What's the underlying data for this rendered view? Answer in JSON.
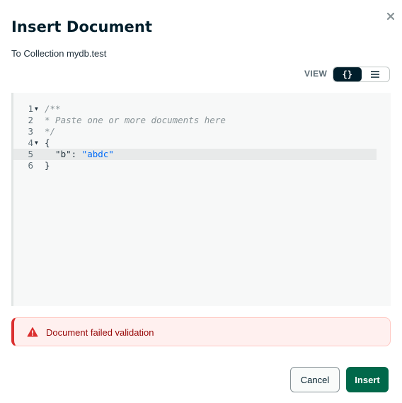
{
  "modal": {
    "title": "Insert Document",
    "subtitle": "To Collection mydb.test",
    "close_icon": "close-icon"
  },
  "view_toggle": {
    "label": "VIEW",
    "options": [
      {
        "name": "json-view",
        "icon": "braces-icon",
        "glyph": "{}",
        "active": true
      },
      {
        "name": "list-view",
        "icon": "list-icon",
        "glyph": "☰",
        "active": false
      }
    ]
  },
  "editor": {
    "lines": [
      {
        "number": "1",
        "foldable": true,
        "tokens": [
          {
            "type": "comment",
            "text": "/**"
          }
        ]
      },
      {
        "number": "2",
        "foldable": false,
        "tokens": [
          {
            "type": "comment",
            "text": "* Paste one or more documents here"
          }
        ]
      },
      {
        "number": "3",
        "foldable": false,
        "tokens": [
          {
            "type": "comment",
            "text": "*/"
          }
        ]
      },
      {
        "number": "4",
        "foldable": true,
        "tokens": [
          {
            "type": "punct",
            "text": "{"
          }
        ]
      },
      {
        "number": "5",
        "foldable": false,
        "highlight": true,
        "tokens": [
          {
            "type": "key",
            "text": "  \"b\""
          },
          {
            "type": "punct",
            "text": ": "
          },
          {
            "type": "string",
            "text": "\"abdc\""
          }
        ]
      },
      {
        "number": "6",
        "foldable": false,
        "tokens": [
          {
            "type": "punct",
            "text": "}"
          }
        ]
      }
    ]
  },
  "alert": {
    "icon": "warning-icon",
    "message": "Document failed validation"
  },
  "footer": {
    "cancel_label": "Cancel",
    "insert_label": "Insert"
  },
  "colors": {
    "insert_button": "#00684a",
    "alert_border": "#db3030",
    "alert_background": "#fff0ef",
    "string_token": "#016bf8",
    "active_toggle": "#001e2b"
  }
}
